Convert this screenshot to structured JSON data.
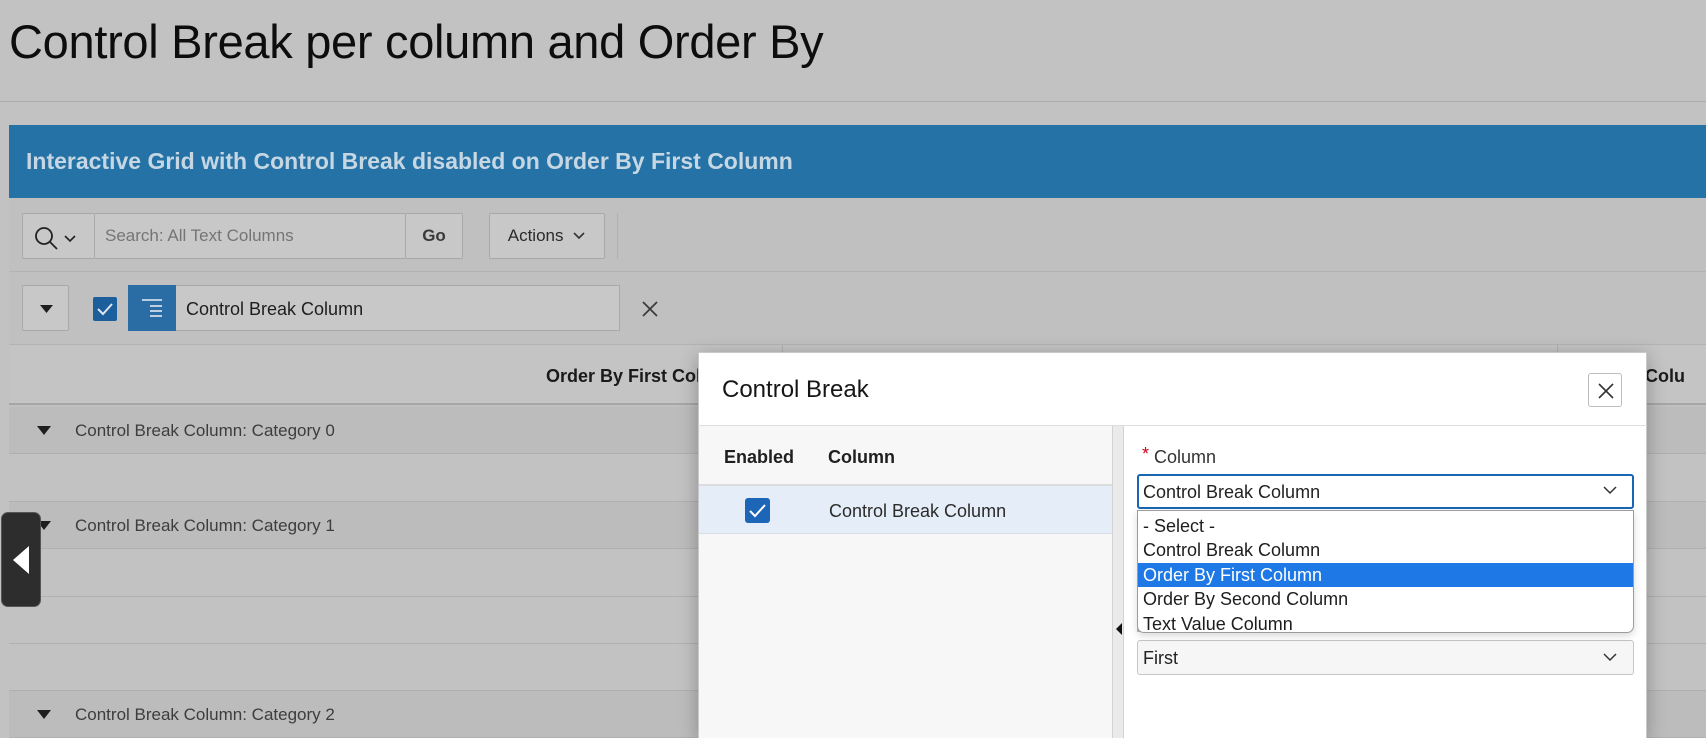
{
  "page": {
    "title": "Control Break per column and Order By"
  },
  "region": {
    "title": "Interactive Grid with Control Break disabled on Order By First Column"
  },
  "toolbar": {
    "search_placeholder": "Search: All Text Columns",
    "go_label": "Go",
    "actions_label": "Actions",
    "search_icon": "magnifier-icon"
  },
  "filter": {
    "chip_label": "Control Break Column",
    "enabled": true
  },
  "grid": {
    "columns": [
      "Order By First Colu",
      "e Colu"
    ],
    "control_breaks": [
      "Control Break Column: Category 0",
      "Control Break Column: Category 1",
      "Control Break Column: Category 2"
    ]
  },
  "dialog": {
    "title": "Control Break",
    "left_pane": {
      "header_enabled": "Enabled",
      "header_column": "Column",
      "rows": [
        {
          "enabled": true,
          "column": "Control Break Column"
        }
      ]
    },
    "right_pane": {
      "required_marker": "*",
      "column_label": "Column",
      "column_value": "Control Break Column",
      "options": [
        "- Select -",
        "Control Break Column",
        "Order By First Column",
        "Order By Second Column",
        "Text Value Column"
      ],
      "highlighted_option": "Order By First Column",
      "order_value": "First"
    }
  },
  "colors": {
    "region_header": "#2573a6",
    "accent": "#1d66b7",
    "option_highlight": "#1e79e6",
    "required": "#d0021b"
  }
}
